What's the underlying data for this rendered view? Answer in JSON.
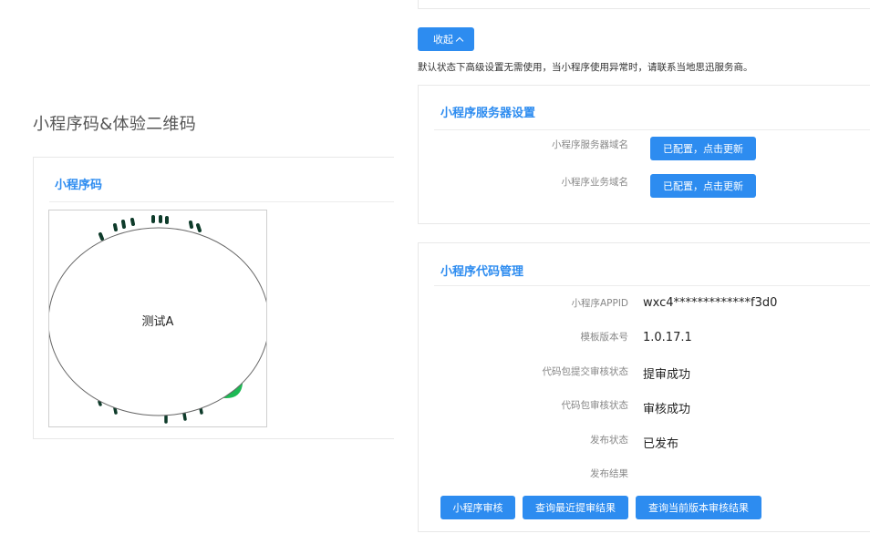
{
  "left": {
    "section_title": "小程序码&体验二维码",
    "qr_panel_title": "小程序码",
    "qr_center_label": "测试A"
  },
  "right": {
    "collapse_label": "收起",
    "note": "默认状态下高级设置无需使用，当小程序使用异常时，请联系当地思迅服务商。",
    "server_settings": {
      "title": "小程序服务器设置",
      "rows": [
        {
          "label": "小程序服务器域名",
          "button": "已配置，点击更新"
        },
        {
          "label": "小程序业务域名",
          "button": "已配置，点击更新"
        }
      ]
    },
    "code_mgmt": {
      "title": "小程序代码管理",
      "rows": [
        {
          "label": "小程序APPID",
          "value": "wxc4*************f3d0"
        },
        {
          "label": "模板版本号",
          "value": "1.0.17.1"
        },
        {
          "label": "代码包提交审核状态",
          "value": "提审成功"
        },
        {
          "label": "代码包审核状态",
          "value": "审核成功"
        },
        {
          "label": "发布状态",
          "value": "已发布"
        },
        {
          "label": "发布结果",
          "value": ""
        }
      ],
      "buttons": [
        "小程序审核",
        "查询最近提审结果",
        "查询当前版本审核结果"
      ]
    }
  },
  "colors": {
    "primary": "#2d8cf0",
    "qr_green": "#1db954",
    "qr_dark": "#0e3b2a"
  },
  "icons": {
    "collapse": "chevron-up-icon"
  }
}
